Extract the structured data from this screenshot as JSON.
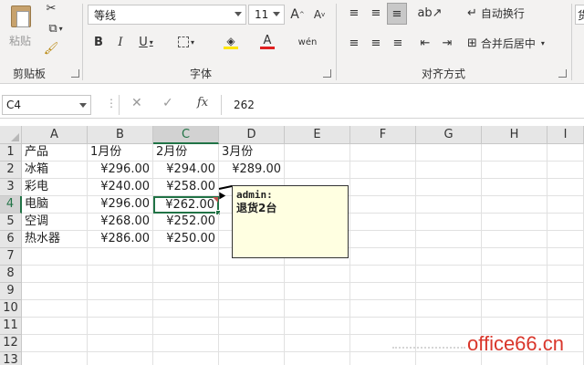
{
  "ribbon": {
    "clipboard": {
      "paste_label": "粘贴",
      "group_label": "剪贴板"
    },
    "font": {
      "font_name": "等线",
      "font_size": "11",
      "grow_label": "A",
      "shrink_label": "A",
      "bold_label": "B",
      "italic_label": "I",
      "underline_label": "U",
      "font_color_label": "A",
      "phonetic_label": "wén",
      "group_label": "字体",
      "font_color": "#e02020",
      "highlight_color": "#ffe600"
    },
    "alignment": {
      "wrap_text_label": "自动换行",
      "merge_center_label": "合并后居中",
      "group_label": "对齐方式"
    },
    "number": {
      "partial_label": "货"
    }
  },
  "formula_bar": {
    "name_box": "C4",
    "fx_label": "fx",
    "formula": "262"
  },
  "sheet": {
    "columns": [
      "A",
      "B",
      "C",
      "D",
      "E",
      "F",
      "G",
      "H",
      "I"
    ],
    "rows": [
      "1",
      "2",
      "3",
      "4",
      "5",
      "6",
      "7",
      "8",
      "9",
      "10",
      "11",
      "12",
      "13"
    ],
    "data": [
      [
        "产品",
        "1月份",
        "2月份",
        "3月份"
      ],
      [
        "冰箱",
        "¥296.00",
        "¥294.00",
        "¥289.00"
      ],
      [
        "彩电",
        "¥240.00",
        "¥258.00",
        ""
      ],
      [
        "电脑",
        "¥296.00",
        "¥262.00",
        ""
      ],
      [
        "空调",
        "¥268.00",
        "¥252.00",
        ""
      ],
      [
        "热水器",
        "¥286.00",
        "¥250.00",
        ""
      ]
    ],
    "active_cell": "C4",
    "accent_color": "#217346"
  },
  "comment": {
    "author": "admin:",
    "text": "退货2台"
  },
  "watermark": "office66.cn"
}
